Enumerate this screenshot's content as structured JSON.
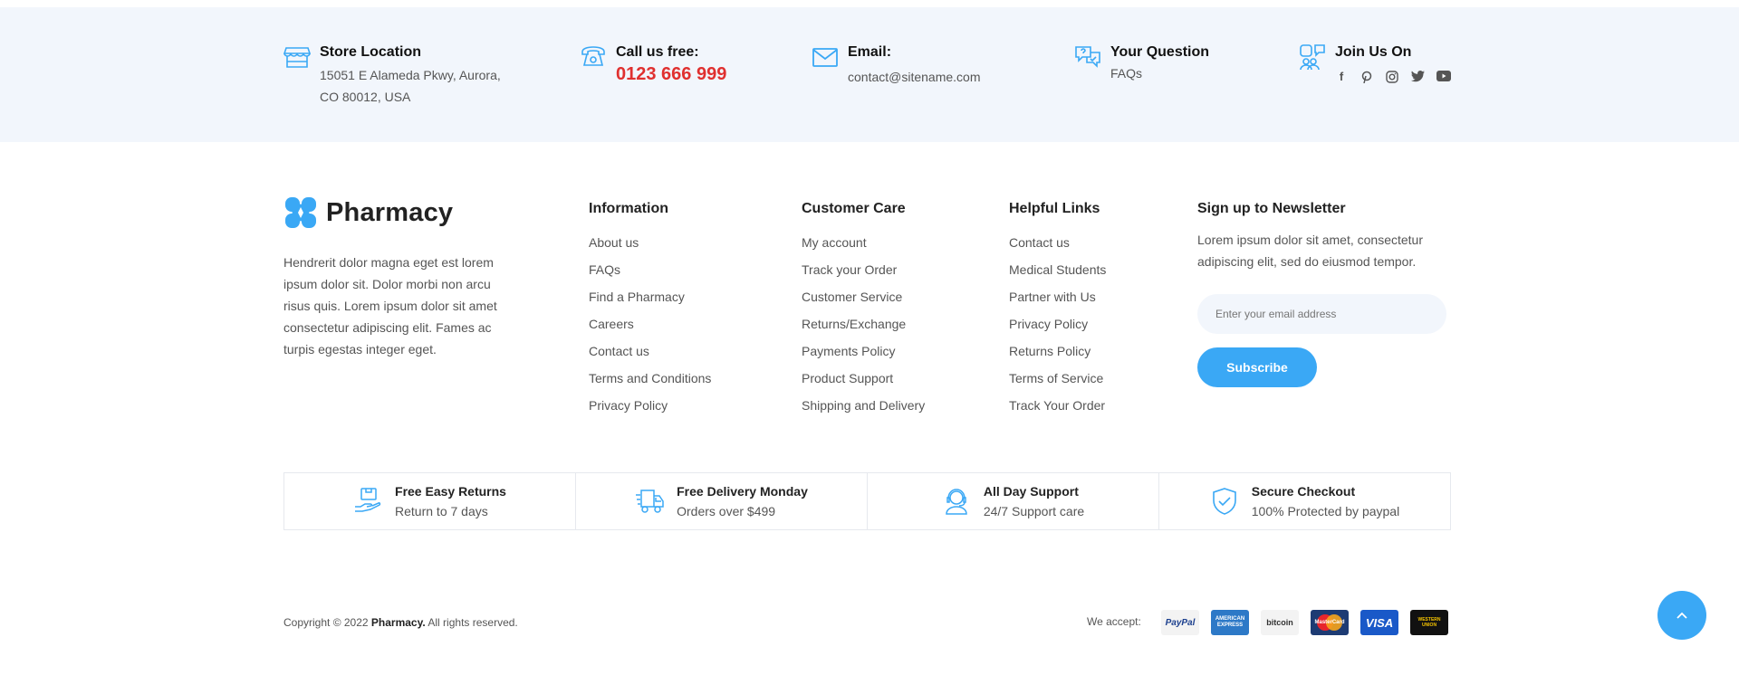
{
  "topbar": {
    "store": {
      "title": "Store Location",
      "line1": "15051 E Alameda Pkwy, Aurora,",
      "line2": "CO 80012, USA"
    },
    "call": {
      "title": "Call us free:",
      "phone": "0123 666 999"
    },
    "email": {
      "title": "Email:",
      "value": "contact@sitename.com"
    },
    "question": {
      "title": "Your Question",
      "link": "FAQs"
    },
    "join": {
      "title": "Join Us On",
      "icons": [
        "facebook-icon",
        "pinterest-icon",
        "instagram-icon",
        "twitter-icon",
        "youtube-icon"
      ]
    }
  },
  "brand": {
    "name": "Pharmacy",
    "description": "Hendrerit dolor magna eget est lorem ipsum dolor sit. Dolor morbi non arcu risus quis. Lorem ipsum dolor sit amet consectetur adipiscing elit. Fames ac turpis egestas integer eget."
  },
  "columns": {
    "information": {
      "title": "Information",
      "links": [
        "About us",
        "FAQs",
        "Find a Pharmacy",
        "Careers",
        "Contact us",
        "Terms and Conditions",
        "Privacy Policy"
      ]
    },
    "customer_care": {
      "title": "Customer Care",
      "links": [
        "My account",
        "Track your Order",
        "Customer Service",
        "Returns/Exchange",
        "Payments Policy",
        "Product Support",
        "Shipping and Delivery"
      ]
    },
    "helpful": {
      "title": "Helpful Links",
      "links": [
        "Contact us",
        "Medical Students",
        "Partner with Us",
        "Privacy Policy",
        "Returns Policy",
        "Terms of Service",
        "Track Your Order"
      ]
    }
  },
  "newsletter": {
    "title": "Sign up to Newsletter",
    "text": "Lorem ipsum dolor sit amet, consectetur adipiscing elit, sed do eiusmod tempor.",
    "placeholder": "Enter your email address",
    "button": "Subscribe"
  },
  "features": [
    {
      "title": "Free Easy Returns",
      "sub": "Return to 7 days",
      "icon": "hand-box-icon"
    },
    {
      "title": "Free Delivery Monday",
      "sub": "Orders over $499",
      "icon": "truck-icon"
    },
    {
      "title": "All Day Support",
      "sub": "24/7 Support care",
      "icon": "support-agent-icon"
    },
    {
      "title": "Secure Checkout",
      "sub": "100% Protected by paypal",
      "icon": "shield-check-icon"
    }
  ],
  "bottom": {
    "copyright_pre": "Copyright © 2022",
    "copyright_brand": "Pharmacy.",
    "copyright_post": "All rights reserved.",
    "accept_label": "We accept:",
    "cards": [
      "PayPal",
      "AMERICAN EXPRESS",
      "bitcoin",
      "MasterCard",
      "VISA",
      "WESTERN UNION"
    ]
  },
  "colors": {
    "accent": "#3aa8f5",
    "phone": "#e0302f",
    "topbar_bg": "#f2f6fc"
  }
}
